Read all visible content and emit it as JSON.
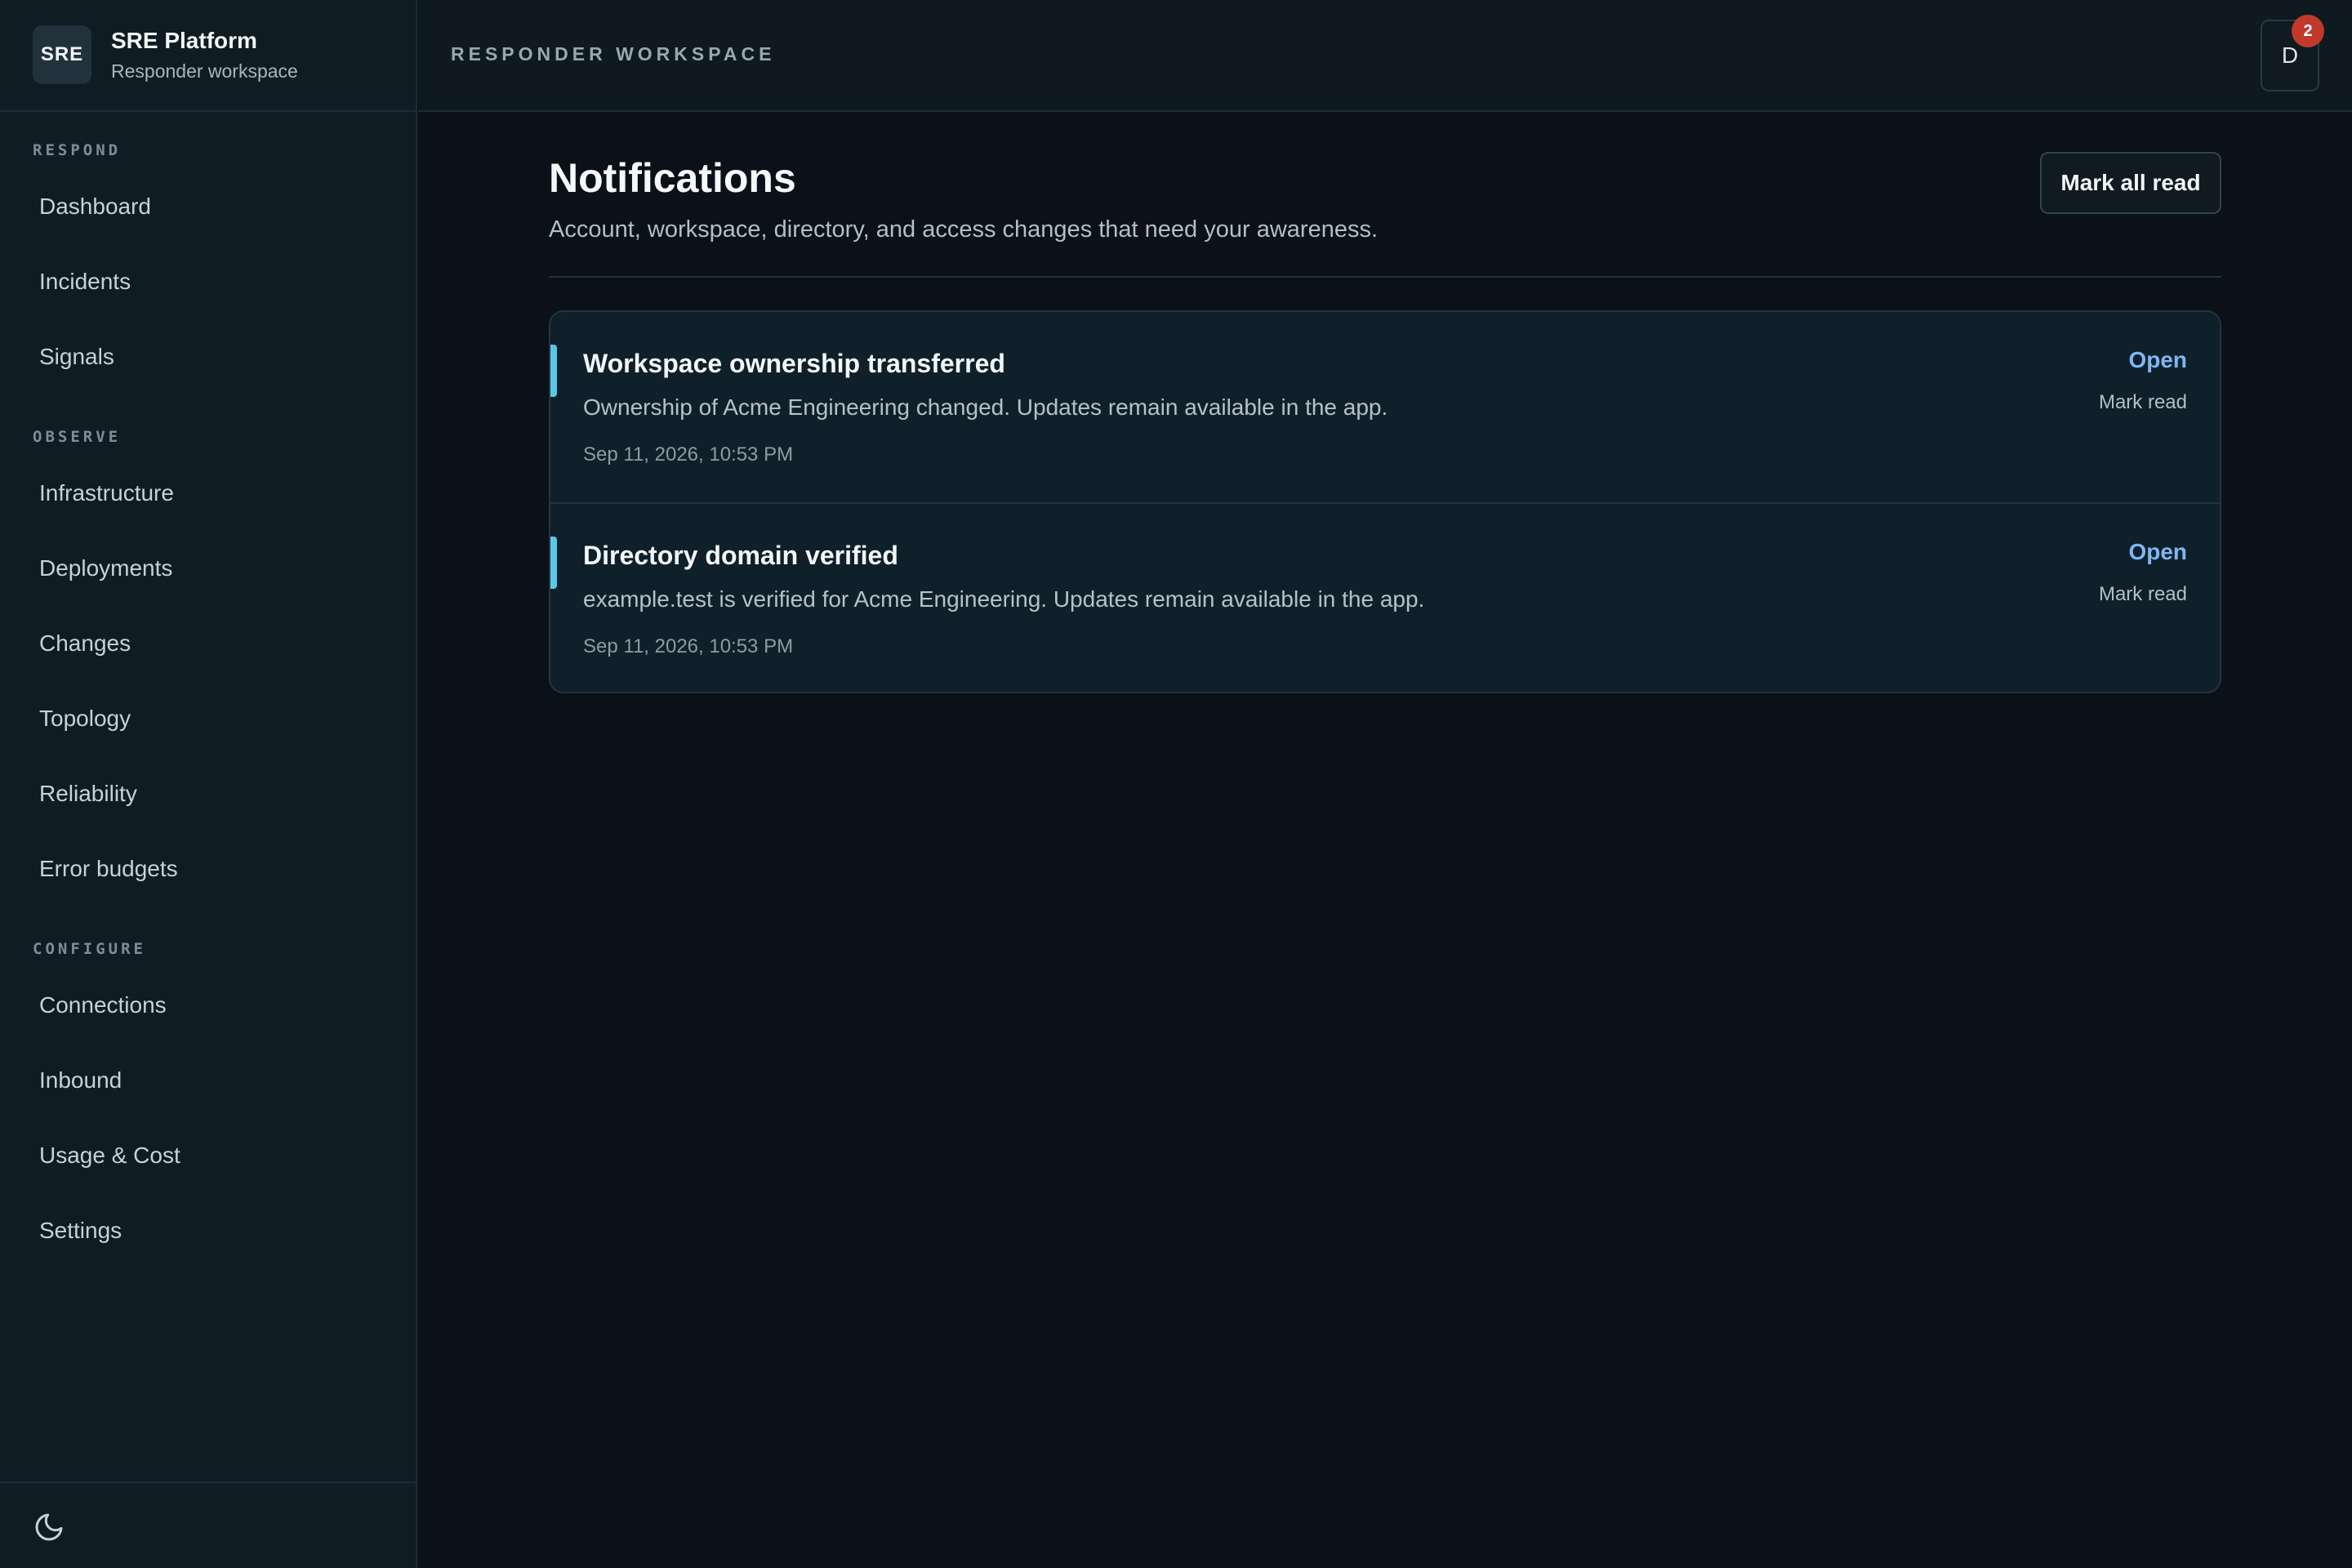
{
  "brand": {
    "logo": "SRE",
    "title": "SRE Platform",
    "subtitle": "Responder workspace"
  },
  "topbar": {
    "title": "RESPONDER WORKSPACE",
    "avatar_initial": "D",
    "notification_count": "2"
  },
  "sidebar": {
    "sections": [
      {
        "label": "RESPOND",
        "items": [
          "Dashboard",
          "Incidents",
          "Signals"
        ]
      },
      {
        "label": "OBSERVE",
        "items": [
          "Infrastructure",
          "Deployments",
          "Changes",
          "Topology",
          "Reliability",
          "Error budgets"
        ]
      },
      {
        "label": "CONFIGURE",
        "items": [
          "Connections",
          "Inbound",
          "Usage & Cost",
          "Settings"
        ]
      }
    ],
    "footer_icon": "moon-icon"
  },
  "page": {
    "title": "Notifications",
    "subtitle": "Account, workspace, directory, and access changes that need your awareness.",
    "mark_all_label": "Mark all read"
  },
  "notifications": [
    {
      "title": "Workspace ownership transferred",
      "body": "Ownership of Acme Engineering changed. Updates remain available in the app.",
      "time": "Sep 11, 2026, 10:53 PM",
      "open_label": "Open",
      "mark_label": "Mark read"
    },
    {
      "title": "Directory domain verified",
      "body": "example.test is verified for Acme Engineering. Updates remain available in the app.",
      "time": "Sep 11, 2026, 10:53 PM",
      "open_label": "Open",
      "mark_label": "Mark read"
    }
  ],
  "colors": {
    "background": "#0a1118",
    "sidebar": "#0f1c24",
    "accent": "#5ec5e6",
    "link": "#7fb6f2",
    "badge": "#c0392b"
  }
}
